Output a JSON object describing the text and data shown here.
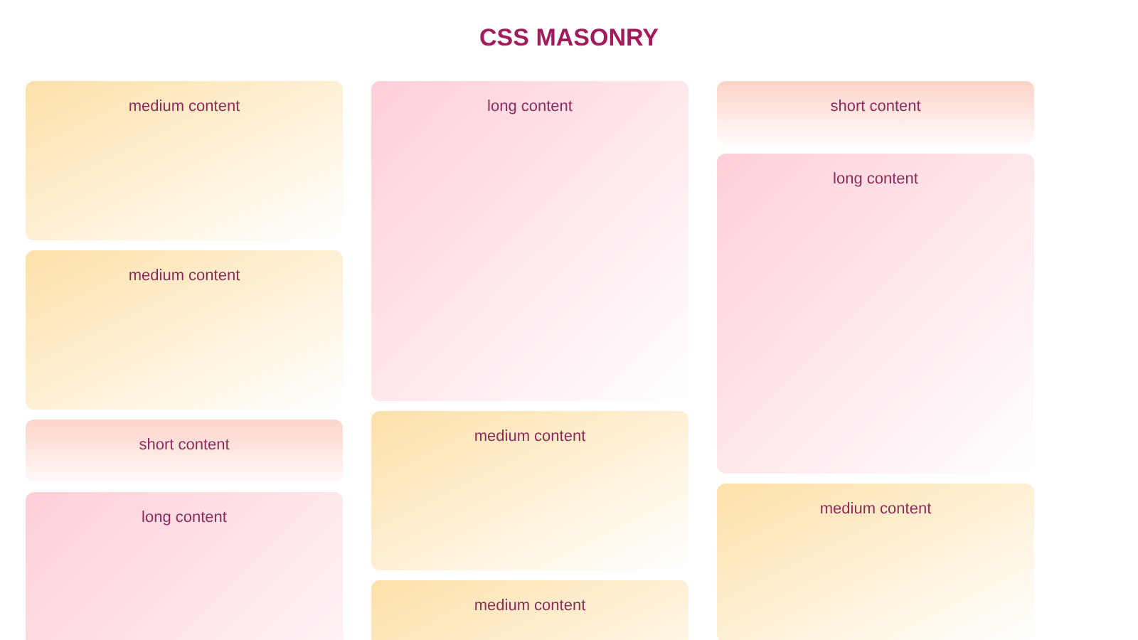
{
  "title": "CSS MASONRY",
  "columns": [
    {
      "cards": [
        {
          "kind": "medium",
          "label": "medium content"
        },
        {
          "kind": "medium",
          "label": "medium content"
        },
        {
          "kind": "short",
          "label": "short content"
        },
        {
          "kind": "long",
          "label": "long content"
        }
      ]
    },
    {
      "cards": [
        {
          "kind": "long",
          "label": "long content"
        },
        {
          "kind": "medium",
          "label": "medium content"
        },
        {
          "kind": "medium",
          "label": "medium content"
        }
      ]
    },
    {
      "cards": [
        {
          "kind": "short",
          "label": "short content"
        },
        {
          "kind": "long",
          "label": "long content"
        },
        {
          "kind": "medium",
          "label": "medium content"
        }
      ]
    }
  ]
}
